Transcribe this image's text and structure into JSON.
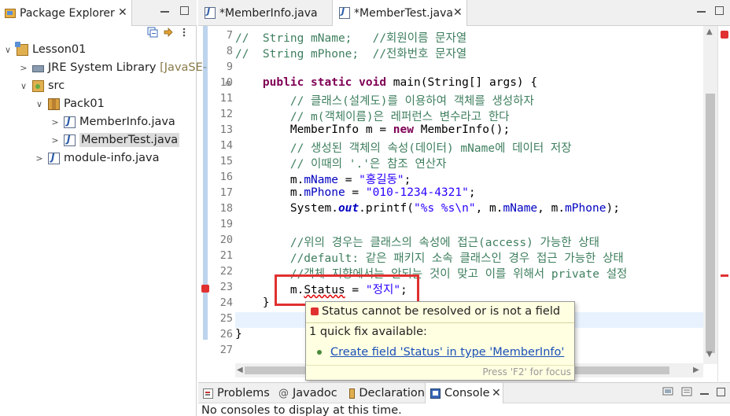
{
  "package_explorer": {
    "title": "Package Explorer",
    "tree": [
      {
        "label": "Lesson01",
        "icon": "project-icon",
        "twist": "∨",
        "indent": 0
      },
      {
        "label": "JRE System Library",
        "suffix": "[JavaSE-",
        "icon": "library-icon",
        "twist": ">",
        "indent": 1
      },
      {
        "label": "src",
        "icon": "source-folder-icon",
        "twist": "∨",
        "indent": 1
      },
      {
        "label": "Pack01",
        "icon": "package-icon",
        "twist": "∨",
        "indent": 2
      },
      {
        "label": "MemberInfo.java",
        "icon": "java-file-icon",
        "twist": ">",
        "indent": 3
      },
      {
        "label": "MemberTest.java",
        "icon": "java-file-icon",
        "twist": ">",
        "indent": 3,
        "selected": true
      },
      {
        "label": "module-info.java",
        "icon": "java-file-icon",
        "twist": ">",
        "indent": 2
      }
    ]
  },
  "editor": {
    "tabs": [
      {
        "label": "*MemberInfo.java",
        "active": false
      },
      {
        "label": "*MemberTest.java",
        "active": true
      }
    ],
    "line_numbers": [
      "7",
      "8",
      "9",
      "10",
      "11",
      "12",
      "13",
      "14",
      "15",
      "16",
      "17",
      "18",
      "19",
      "20",
      "21",
      "22",
      "23",
      "24",
      "25",
      "26",
      "27"
    ],
    "lines": {
      "l7": "//  String mName;   //회원이름 문자열",
      "l8": "//  String mPhone;  //전화번호 문자열",
      "l10_kw": "public static void",
      "l10_rest": " main(String[] args) {",
      "l11": "// 클래스(설계도)를 이용하여 객체를 생성하자",
      "l12": "// m(객체이름)은 레퍼런스 변수라고 한다",
      "l13_a": "MemberInfo m = ",
      "l13_kw": "new",
      "l13_b": " MemberInfo();",
      "l14": "// 생성된 객체의 속성(데이터) mName에 데이터 저장",
      "l15": "// 이때의 '.'은 참조 연산자",
      "l16_a": "m.",
      "l16_f": "mName",
      "l16_b": " = ",
      "l16_s": "\"홍길동\"",
      "l16_c": ";",
      "l17_a": "m.",
      "l17_f": "mPhone",
      "l17_b": " = ",
      "l17_s": "\"010-1234-4321\"",
      "l17_c": ";",
      "l18_a": "System.",
      "l18_f": "out",
      "l18_b": ".printf(",
      "l18_s": "\"%s %s\\n\"",
      "l18_c": ", m.",
      "l18_f2": "mName",
      "l18_d": ", m.",
      "l18_f3": "mPhone",
      "l18_e": ");",
      "l20": "//위의 경우는 클래스의 속성에 접근(access) 가능한 상태",
      "l21": "//default: 같은 패키지 소속 클래스인 경우 접근 가능한 상태",
      "l22": "//객체 지향에서는 안되는 것이 맞고 이를 위해서 private 설정",
      "l23_a": "m.",
      "l23_err": "Status",
      "l23_b": " = ",
      "l23_s": "\"정지\"",
      "l23_c": ";",
      "l24": "}",
      "l26": "}"
    }
  },
  "quickfix": {
    "message": "Status cannot be resolved or is not a field",
    "count": "1 quick fix available:",
    "fix": "Create field 'Status' in type 'MemberInfo'",
    "focus_hint": "Press 'F2' for focus"
  },
  "bottom": {
    "tabs": [
      {
        "label": "Problems",
        "icon": "problems-icon"
      },
      {
        "label": "Javadoc",
        "icon": "javadoc-icon"
      },
      {
        "label": "Declaration",
        "icon": "declaration-icon"
      },
      {
        "label": "Console",
        "icon": "console-icon",
        "active": true
      }
    ],
    "message": "No consoles to display at this time."
  },
  "colors": {
    "keyword": "#7f0055",
    "comment": "#3f7f5f",
    "string": "#2a00ff",
    "field": "#0000c0",
    "error": "#e03030"
  }
}
